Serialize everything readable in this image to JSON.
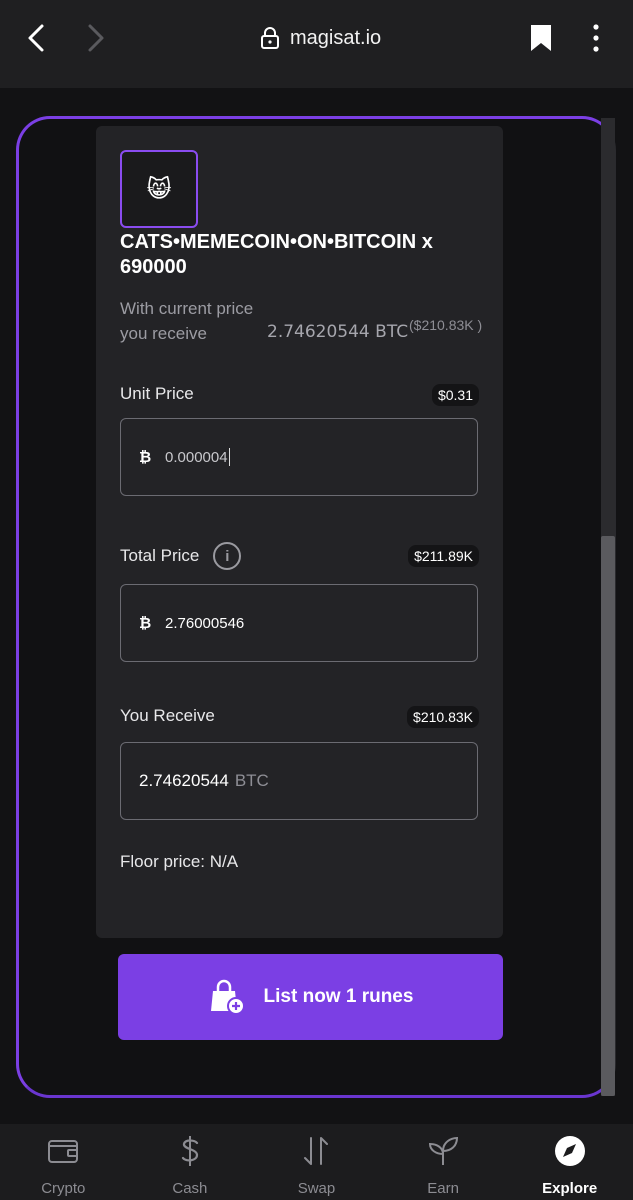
{
  "browser": {
    "url": "magisat.io"
  },
  "token": {
    "emoji": "😸",
    "title": "CATS•MEMECOIN•ON•BITCOIN x 690000"
  },
  "receive_summary": {
    "label": "With current price you receive",
    "value": "2.74620544 BTC",
    "usd": "($210.83K )"
  },
  "unit_price": {
    "label": "Unit Price",
    "usd": "$0.31",
    "value": "0.000004"
  },
  "total_price": {
    "label": "Total Price",
    "usd": "$211.89K",
    "value": "2.76000546"
  },
  "you_receive": {
    "label": "You Receive",
    "usd": "$210.83K",
    "value": "2.74620544",
    "unit": "BTC"
  },
  "floor_price": "Floor price: N/A",
  "list_button": "List now 1 runes",
  "btc_symbol": "₿",
  "tabs": [
    {
      "label": "Crypto",
      "icon": "wallet-icon"
    },
    {
      "label": "Cash",
      "icon": "dollar-icon"
    },
    {
      "label": "Swap",
      "icon": "swap-icon"
    },
    {
      "label": "Earn",
      "icon": "sprout-icon"
    },
    {
      "label": "Explore",
      "icon": "compass-icon",
      "active": true
    }
  ],
  "colors": {
    "accent": "#7b3fe4",
    "card": "#232326",
    "background": "#121214"
  }
}
